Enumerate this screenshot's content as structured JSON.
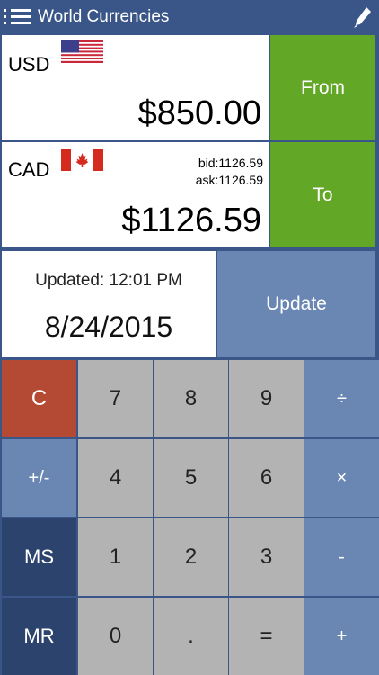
{
  "header": {
    "title": "World Currencies"
  },
  "from_currency": {
    "code": "USD",
    "amount": "$850.00"
  },
  "to_currency": {
    "code": "CAD",
    "amount": "$1126.59",
    "bid": "bid:1126.59",
    "ask": "ask:1126.59"
  },
  "buttons": {
    "from": "From",
    "to": "To",
    "update": "Update"
  },
  "updated": {
    "label": "Updated: 12:01 PM",
    "date": "8/24/2015"
  },
  "keypad": {
    "c": "C",
    "sign": "+/-",
    "ms": "MS",
    "mr": "MR",
    "k7": "7",
    "k8": "8",
    "k9": "9",
    "k4": "4",
    "k5": "5",
    "k6": "6",
    "k1": "1",
    "k2": "2",
    "k3": "3",
    "k0": "0",
    "dot": ".",
    "eq": "=",
    "div": "÷",
    "mul": "×",
    "sub": "-",
    "add": "+"
  },
  "colors": {
    "background": "#3a5688",
    "green": "#63a726",
    "clear_red": "#b54a34",
    "op_blue": "#6a87b3",
    "memory_navy": "#2c446d",
    "digit_gray": "#b3b3b3"
  },
  "icons": {
    "menu": "menu-icon",
    "edit": "pencil-icon",
    "from_flag": "us-flag-icon",
    "to_flag": "canada-flag-icon"
  }
}
